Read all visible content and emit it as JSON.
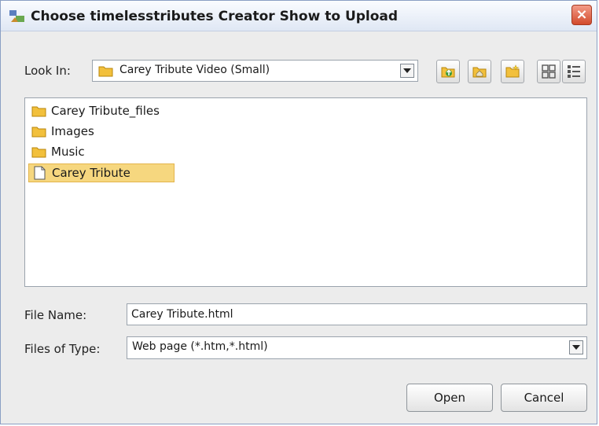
{
  "dialog": {
    "title": "Choose timelesstributes Creator Show to Upload",
    "close_label": "×"
  },
  "look_in": {
    "label": "Look In:",
    "value": "Carey Tribute Video (Small)"
  },
  "toolbar": {
    "icons": [
      "up-folder-icon",
      "home-icon",
      "new-folder-icon",
      "list-view-icon",
      "details-view-icon"
    ]
  },
  "files": [
    {
      "name": "Carey Tribute_files",
      "type": "folder",
      "selected": false
    },
    {
      "name": "Images",
      "type": "folder",
      "selected": false
    },
    {
      "name": "Music",
      "type": "folder",
      "selected": false
    },
    {
      "name": "Carey Tribute",
      "type": "file",
      "selected": true
    }
  ],
  "file_name": {
    "label": "File Name:",
    "value": "Carey Tribute.html"
  },
  "file_type": {
    "label": "Files of Type:",
    "value": "Web page (*.htm,*.html)"
  },
  "buttons": {
    "open": "Open",
    "cancel": "Cancel"
  },
  "colors": {
    "selection": "#f6d77f",
    "folder": "#f2c03c",
    "close": "#d24a2c"
  }
}
